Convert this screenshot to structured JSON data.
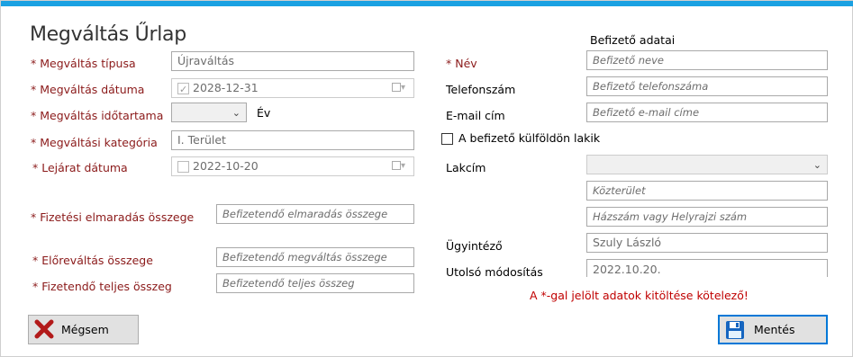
{
  "form": {
    "title": "Megváltás Űrlap",
    "payer_header": "Befizető adatai",
    "required_note": "A *-gal jelölt adatok kitöltése kötelező!"
  },
  "left": {
    "type_label": "* Megváltás típusa",
    "type_value": "Újraváltás",
    "date_label": "* Megváltás dátuma",
    "date_value": "2028-12-31",
    "duration_label": "* Megváltás időtartama",
    "duration_value": "",
    "duration_unit": "Év",
    "category_label": "* Megváltási kategória",
    "category_value": "I. Terület",
    "expiry_label": "* Lejárat dátuma",
    "expiry_value": "2022-10-20",
    "arrears_label": "* Fizetési elmaradás összege",
    "arrears_placeholder": "Befizetendő elmaradás összege",
    "prepay_label": "* Előreváltás összege",
    "prepay_placeholder": "Befizetendő megváltás összege",
    "total_label": "* Fizetendő teljes összeg",
    "total_placeholder": "Befizetendő teljes összeg"
  },
  "right": {
    "name_label": "* Név",
    "name_placeholder": "Befizető neve",
    "phone_label": "Telefonszám",
    "phone_placeholder": "Befizető telefonszáma",
    "email_label": "E-mail cím",
    "email_placeholder": "Befizető e-mail címe",
    "abroad_label": "A befizető külföldön lakik",
    "address_label": "Lakcím",
    "address_value": "",
    "street_placeholder": "Közterület",
    "house_placeholder": "Házszám vagy Helyrajzi szám",
    "clerk_label": "Ügyintéző",
    "clerk_value": "Szuly László",
    "modified_label": "Utolsó módosítás",
    "modified_value": "2022.10.20."
  },
  "buttons": {
    "cancel": "Mégsem",
    "save": "Mentés"
  },
  "colors": {
    "accent": "#1ba1e2",
    "required": "#8b1a1a",
    "error": "#c00000"
  }
}
